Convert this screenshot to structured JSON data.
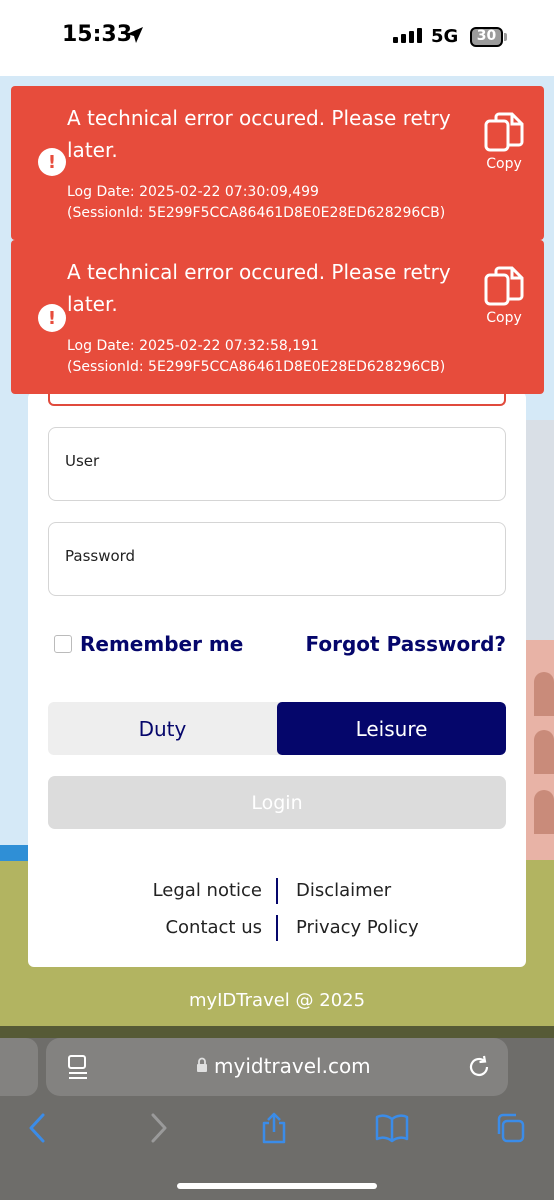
{
  "status_bar": {
    "time": "15:33",
    "network": "5G",
    "battery": "30"
  },
  "errors": [
    {
      "message": "A technical error occured. Please retry later.",
      "log_date": "Log Date: 2025-02-22 07:30:09,499",
      "session": "(SessionId: 5E299F5CCA86461D8E0E28ED628296CB)",
      "copy_label": "Copy"
    },
    {
      "message": "A technical error occured. Please retry later.",
      "log_date": "Log Date: 2025-02-22 07:32:58,191",
      "session": "(SessionId: 5E299F5CCA86461D8E0E28ED628296CB)",
      "copy_label": "Copy"
    }
  ],
  "form": {
    "user_label": "User",
    "password_label": "Password",
    "remember_label": "Remember me",
    "forgot_label": "Forgot Password?",
    "duty_label": "Duty",
    "leisure_label": "Leisure",
    "login_label": "Login",
    "selected_mode": "Leisure"
  },
  "links": {
    "legal": "Legal notice",
    "disclaimer": "Disclaimer",
    "contact": "Contact us",
    "privacy": "Privacy Policy"
  },
  "footer": "myIDTravel @ 2025",
  "browser": {
    "url": "myidtravel.com"
  },
  "colors": {
    "error": "#e74c3c",
    "brand": "#05066b",
    "ground": "#b2b461",
    "sky": "#d5e9f7"
  }
}
